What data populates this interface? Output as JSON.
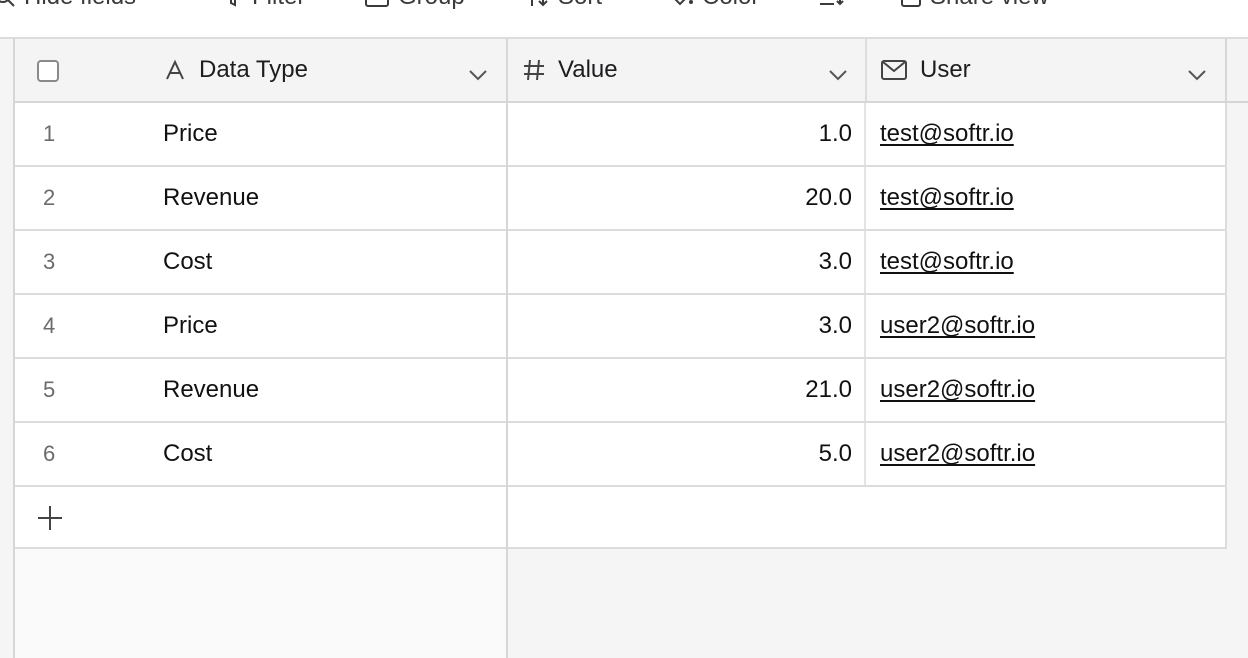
{
  "toolbar": {
    "items": [
      {
        "label": "Hide fields",
        "icon": "search-icon"
      },
      {
        "label": "Filter",
        "icon": "filter-icon"
      },
      {
        "label": "Group",
        "icon": "group-icon"
      },
      {
        "label": "Sort",
        "icon": "sort-icon"
      },
      {
        "label": "Color",
        "icon": "color-icon"
      },
      {
        "label": "",
        "icon": "row-height-icon"
      },
      {
        "label": "Share view",
        "icon": "share-icon"
      }
    ]
  },
  "table": {
    "columns": [
      {
        "label": "Data Type",
        "icon": "text-field-icon"
      },
      {
        "label": "Value",
        "icon": "number-field-icon"
      },
      {
        "label": "User",
        "icon": "email-field-icon"
      }
    ],
    "rows": [
      {
        "num": "1",
        "data_type": "Price",
        "value": "1.0",
        "user": "test@softr.io"
      },
      {
        "num": "2",
        "data_type": "Revenue",
        "value": "20.0",
        "user": "test@softr.io"
      },
      {
        "num": "3",
        "data_type": "Cost",
        "value": "3.0",
        "user": "test@softr.io"
      },
      {
        "num": "4",
        "data_type": "Price",
        "value": "3.0",
        "user": "user2@softr.io"
      },
      {
        "num": "5",
        "data_type": "Revenue",
        "value": "21.0",
        "user": "user2@softr.io"
      },
      {
        "num": "6",
        "data_type": "Cost",
        "value": "5.0",
        "user": "user2@softr.io"
      }
    ]
  }
}
